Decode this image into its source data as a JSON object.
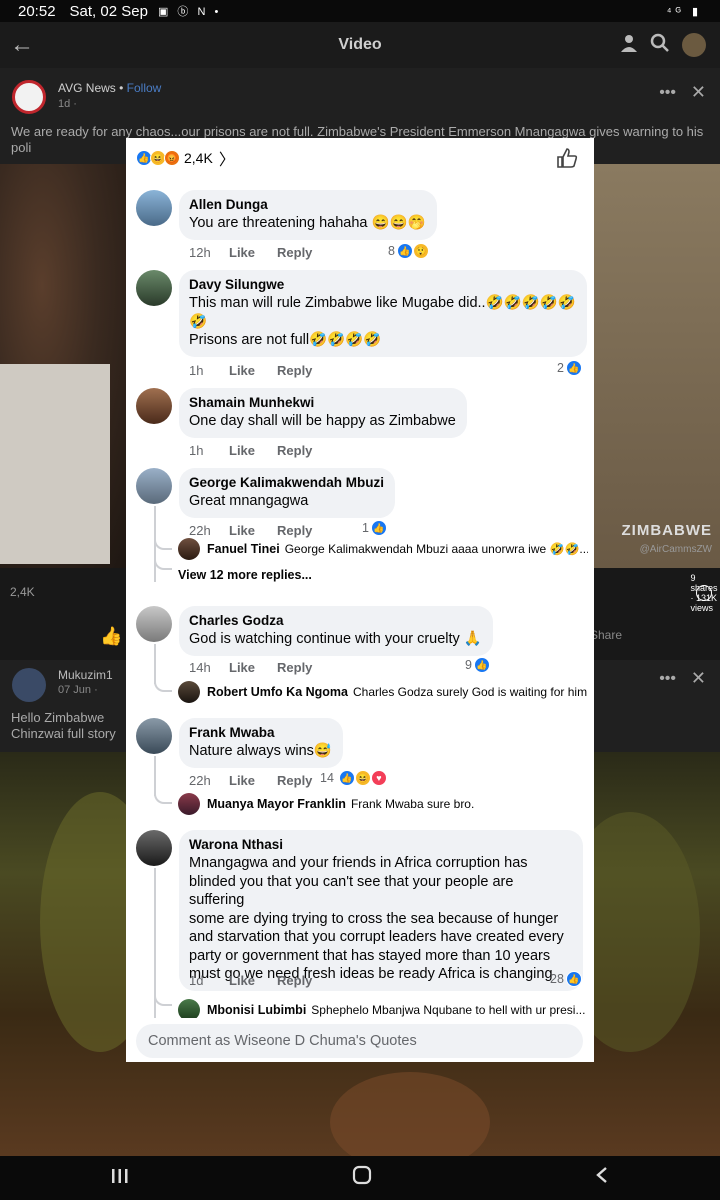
{
  "status_bar": {
    "time": "20:52",
    "date": "Sat, 02 Sep",
    "icons": "▣ ⓑ N •",
    "right_icons": "⁴ᴳ ▮"
  },
  "header": {
    "title": "Video"
  },
  "background_post": {
    "author": "AVG News",
    "follow": "Follow",
    "time": "1d ·",
    "text": "We are ready for any chaos...our prisons are not full. Zimbabwe's President Emmerson Mnangagwa gives warning to his poli",
    "video_stamp": "ZIMBABWE",
    "video_stamp2": "@AirCammsZW",
    "reaction_count": "2,4K",
    "stats_right": "9 shares · 131K views",
    "share_label": "Share"
  },
  "background_post2": {
    "author": "Mukuzim1",
    "time": "07 Jun ·",
    "text_line1": "Hello Zimbabwe",
    "text_line2": "Chinzwai full story"
  },
  "modal": {
    "reaction_count": "2,4K",
    "comments": [
      {
        "name": "Allen Dunga",
        "text": "You are threatening hahaha 😄😄🤭",
        "time": "12h",
        "like": "Like",
        "reply": "Reply",
        "reaction_count": "8"
      },
      {
        "name": "Davy Silungwe",
        "text1": "This man will rule Zimbabwe like Mugabe did..🤣🤣🤣🤣🤣",
        "text2": "🤣",
        "text3": "Prisons are not full🤣🤣🤣🤣",
        "time": "1h",
        "like": "Like",
        "reply": "Reply",
        "reaction_count": "2"
      },
      {
        "name": "Shamain Munhekwi",
        "text": "One day shall will be happy as Zimbabwe",
        "time": "1h",
        "like": "Like",
        "reply": "Reply"
      },
      {
        "name": "George Kalimakwendah Mbuzi",
        "text": "Great mnangagwa",
        "time": "22h",
        "like": "Like",
        "reply": "Reply",
        "reaction_count": "1",
        "reply_preview": {
          "name": "Fanuel Tinei",
          "text": "George Kalimakwendah Mbuzi aaaa unorwra iwe 🤣🤣..."
        },
        "more_replies": "View 12 more replies..."
      },
      {
        "name": "Charles Godza",
        "text": "God is watching continue with your cruelty 🙏",
        "time": "14h",
        "like": "Like",
        "reply": "Reply",
        "reaction_count": "9",
        "reply_preview": {
          "name": "Robert Umfo Ka Ngoma",
          "text": "Charles Godza surely God is waiting for him,"
        }
      },
      {
        "name": "Frank Mwaba",
        "text": "Nature always wins😅",
        "time": "22h",
        "like": "Like",
        "reply": "Reply",
        "reaction_count": "14",
        "reply_preview": {
          "name": "Muanya Mayor Franklin",
          "text": "Frank Mwaba sure bro."
        }
      },
      {
        "name": "Warona Nthasi",
        "lines": [
          "Mnangagwa and your friends in Africa corruption has",
          "blinded you that you can't see that your people are suffering",
          "some are dying trying to cross the sea because of hunger",
          "and starvation that you corrupt leaders have created every",
          "party or government that has stayed more than 10 years",
          "must go we need fresh ideas be ready Africa is changing"
        ],
        "time": "1d",
        "like": "Like",
        "reply": "Reply",
        "reaction_count": "28",
        "reply_preview": {
          "name": "Mbonisi Lubimbi",
          "text": "Sphephelo Mbanjwa Nqubane to hell with ur  presi..."
        }
      }
    ],
    "composer_placeholder": "Comment as Wiseone D Chuma's Quotes"
  },
  "colors": {
    "accent": "#1877f2",
    "bubble": "#f0f2f5",
    "meta": "#65676b"
  }
}
